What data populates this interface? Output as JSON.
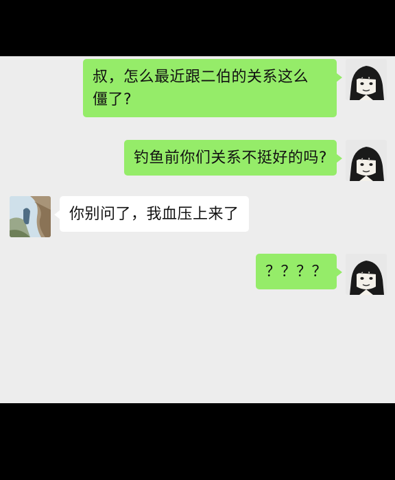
{
  "colors": {
    "background_outer": "#000000",
    "chat_background": "#ededed",
    "outgoing_bubble": "#95ec69",
    "incoming_bubble": "#ffffff",
    "text": "#111111"
  },
  "messages": [
    {
      "sender": "self",
      "avatar": "anime-character-avatar",
      "lines": [
        "叔，怎么最近跟二伯的关系这么",
        "僵了?"
      ]
    },
    {
      "sender": "self",
      "avatar": "anime-character-avatar",
      "lines": [
        "钓鱼前你们关系不挺好的吗?"
      ]
    },
    {
      "sender": "other",
      "avatar": "landscape-photo-avatar",
      "lines": [
        "你别问了，我血压上来了"
      ]
    },
    {
      "sender": "self",
      "avatar": "anime-character-avatar",
      "lines": [
        "？？？？"
      ]
    }
  ]
}
